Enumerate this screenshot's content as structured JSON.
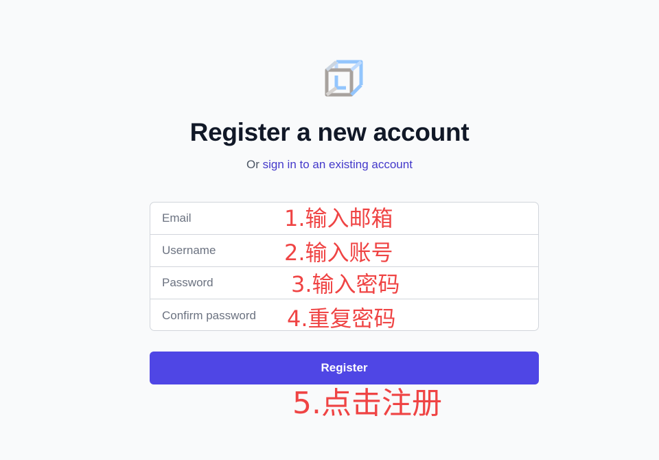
{
  "header": {
    "title": "Register a new account",
    "subtitle_prefix": "Or ",
    "signin_link": "sign in to an existing account"
  },
  "form": {
    "email_placeholder": "Email",
    "username_placeholder": "Username",
    "password_placeholder": "Password",
    "confirm_placeholder": "Confirm password",
    "submit_label": "Register"
  },
  "annotations": {
    "step1": "1.输入邮箱",
    "step2": "2.输入账号",
    "step3": "3.输入密码",
    "step4": "4.重复密码",
    "step5": "5.点击注册"
  },
  "colors": {
    "accent": "#4f46e5",
    "link": "#4338ca",
    "annotation": "#ef4444",
    "background": "#f9fafb"
  },
  "icons": {
    "logo": "impossible-cube-icon"
  }
}
